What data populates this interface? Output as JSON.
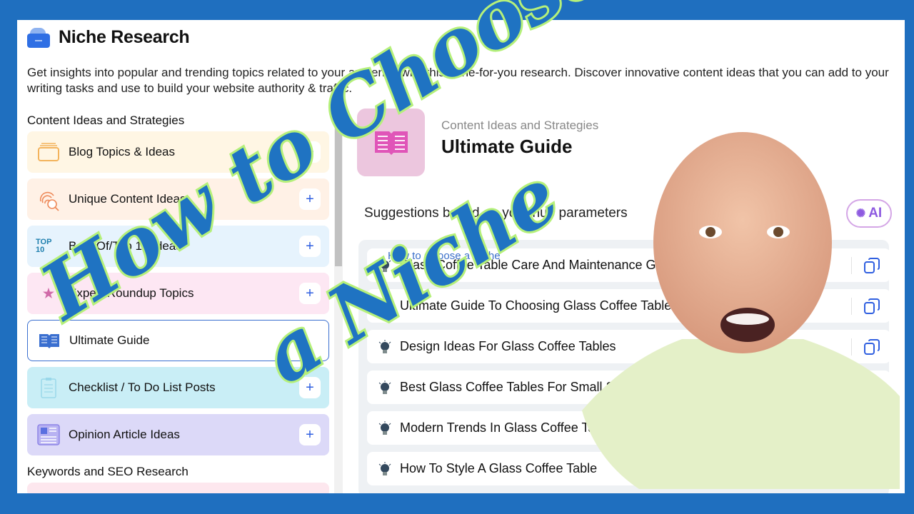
{
  "header": {
    "title": "Niche Research",
    "description": "Get insights into popular and trending topics related to your audience with this done-for-you research. Discover innovative content ideas that you can add to your writing tasks and use to build your website authority & traffic."
  },
  "sidebar": {
    "section_1": "Content Ideas and Strategies",
    "items": [
      {
        "label": "Blog Topics & Ideas",
        "icon": "folder-stack-icon",
        "bg": "#fff6e4",
        "plus": "+"
      },
      {
        "label": "Unique Content Ideas",
        "icon": "fingerprint-search-icon",
        "bg": "#fff1e6",
        "plus": "+"
      },
      {
        "label": "Best Of/Top 10 Ideas",
        "icon": "top-10-icon",
        "icon_text": "TOP 10",
        "bg": "#e6f3fd",
        "plus": "+"
      },
      {
        "label": "Expert Roundup Topics",
        "icon": "star-icon",
        "bg": "#fde7f3",
        "plus": "+"
      },
      {
        "label": "Ultimate Guide",
        "icon": "open-book-icon",
        "bg": "#ffffff",
        "selected": true
      },
      {
        "label": "Checklist / To Do List Posts",
        "icon": "clipboard-checklist-icon",
        "bg": "#c9eef6",
        "plus": "+"
      },
      {
        "label": "Opinion Article Ideas",
        "icon": "newspaper-icon",
        "bg": "#dcd9f8",
        "plus": "+"
      }
    ],
    "section_2": "Keywords and SEO Research"
  },
  "main": {
    "breadcrumb": "Content Ideas and Strategies",
    "heading": "Ultimate Guide",
    "suggestions_label": "Suggestions based on your hub parameters",
    "ai_button": "AI",
    "rows": [
      "Glass Coffee Table Care And Maintenance Guide",
      "Ultimate Guide To Choosing Glass Coffee Tables",
      "Design Ideas For Glass Coffee Tables",
      "Best Glass Coffee Tables For Small Spaces",
      "Modern Trends In Glass Coffee Tables",
      "How To Style A Glass Coffee Table"
    ]
  },
  "overlay": {
    "title_line1": "How to Choose",
    "title_line2": "a Niche",
    "watermark": "How to Choose a Niche"
  },
  "colors": {
    "frame": "#1f6fbf",
    "overlay_fill": "#1f73c2",
    "overlay_stroke": "#b5f07a",
    "accent": "#2f5fe0"
  }
}
